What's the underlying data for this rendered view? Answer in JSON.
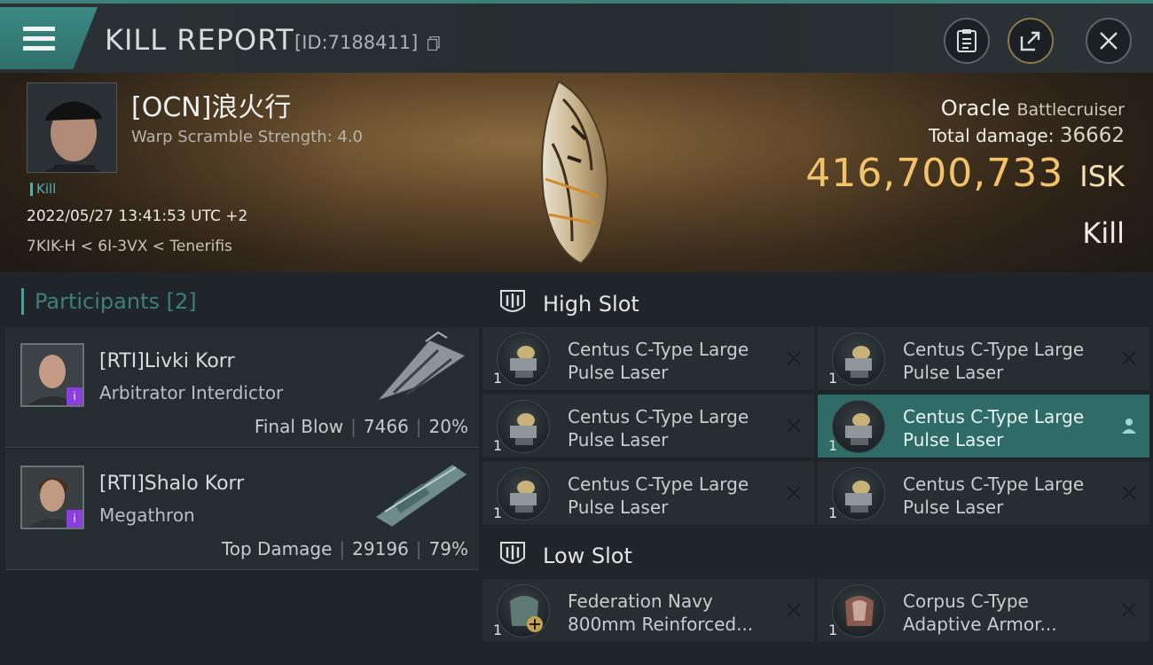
{
  "header": {
    "title": "KILL REPORT",
    "report_id": "[ID:7188411]"
  },
  "victim": {
    "name": "[OCN]浪火行",
    "subtitle": "Warp Scramble Strength: 4.0",
    "tag": "Kill",
    "timestamp": "2022/05/27 13:41:53 UTC +2",
    "location": "7KIK-H < 6I-3VX < Tenerifis"
  },
  "ship": {
    "name": "Oracle",
    "class": "Battlecruiser",
    "total_damage_label": "Total damage:",
    "total_damage": "36662",
    "isk_value": "416,700,733",
    "isk_unit": "ISK",
    "result": "Kill"
  },
  "participants": {
    "label": "Participants",
    "count": "[2]",
    "items": [
      {
        "name": "[RTI]Livki Korr",
        "ship": "Arbitrator Interdictor",
        "role": "Final Blow",
        "damage": "7466",
        "percent": "20%",
        "badge": "i"
      },
      {
        "name": "[RTI]Shalo Korr",
        "ship": "Megathron",
        "role": "Top Damage",
        "damage": "29196",
        "percent": "79%",
        "badge": "i"
      }
    ]
  },
  "slots": {
    "high": {
      "title": "High Slot",
      "modules": [
        {
          "qty": "1",
          "line1": "Centus C-Type Large",
          "line2": "Pulse Laser",
          "active": false
        },
        {
          "qty": "1",
          "line1": "Centus C-Type Large",
          "line2": "Pulse Laser",
          "active": false
        },
        {
          "qty": "1",
          "line1": "Centus C-Type Large",
          "line2": "Pulse Laser",
          "active": false
        },
        {
          "qty": "1",
          "line1": "Centus C-Type Large",
          "line2": "Pulse Laser",
          "active": true
        },
        {
          "qty": "1",
          "line1": "Centus C-Type Large",
          "line2": "Pulse Laser",
          "active": false
        },
        {
          "qty": "1",
          "line1": "Centus C-Type Large",
          "line2": "Pulse Laser",
          "active": false
        }
      ]
    },
    "low": {
      "title": "Low Slot",
      "modules": [
        {
          "qty": "1",
          "line1": "Federation Navy",
          "line2": "800mm Reinforced...",
          "active": false
        },
        {
          "qty": "1",
          "line1": "Corpus C-Type",
          "line2": "Adaptive Armor...",
          "active": false
        }
      ]
    }
  },
  "colors": {
    "accent_teal": "#3f8a84",
    "isk_gold": "#f2c36a",
    "active_row": "#2f6b67"
  },
  "icons": [
    "menu-icon",
    "clipboard-icon",
    "share-icon",
    "close-icon",
    "copy-icon",
    "slot-icon",
    "remove-icon",
    "pilot-icon"
  ]
}
